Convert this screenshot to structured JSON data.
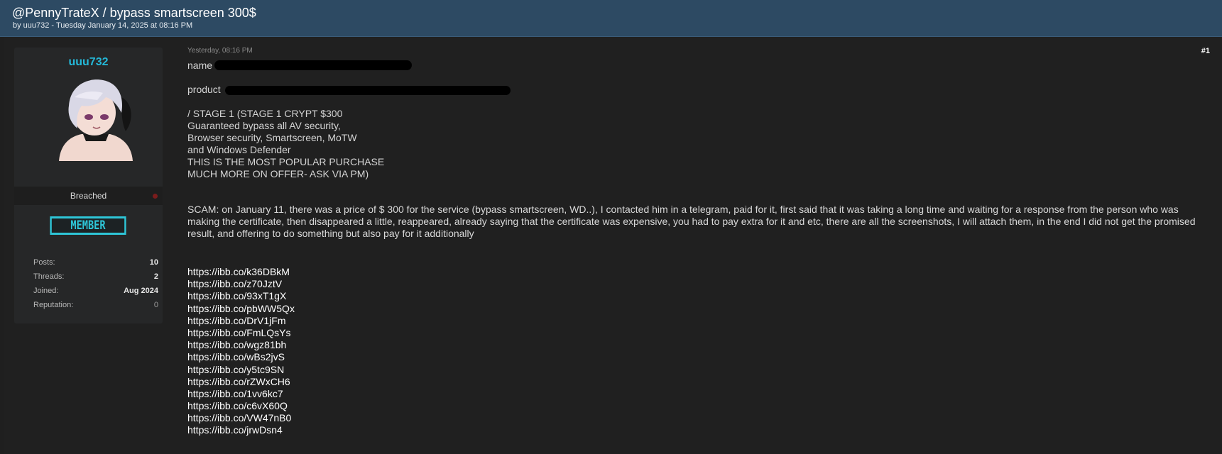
{
  "thread": {
    "title": "@PennyTrateX / bypass smartscreen 300$",
    "meta": "by uuu732 - Tuesday January 14, 2025 at 08:16 PM"
  },
  "user": {
    "username": "uuu732",
    "group": "Breached",
    "rank": "MEMBER",
    "stats": [
      {
        "label": "Posts:",
        "value": "10"
      },
      {
        "label": "Threads:",
        "value": "2"
      },
      {
        "label": "Joined:",
        "value": "Aug 2024"
      },
      {
        "label": "Reputation:",
        "value": "0"
      }
    ],
    "colors": {
      "username": "#24b8d8",
      "rank": "#2ec6d8",
      "status": "#7a1c1c"
    }
  },
  "post": {
    "date": "Yesterday, 08:16 PM",
    "number": "#1",
    "name_label": "name",
    "product_label": "product",
    "offer_lines": [
      "/ STAGE 1 (STAGE 1 CRYPT $300",
      "Guaranteed bypass all AV security,",
      "Browser security, Smartscreen, MoTW",
      "and Windows Defender",
      "THIS IS THE MOST POPULAR PURCHASE",
      "MUCH MORE ON OFFER- ASK VIA PM)"
    ],
    "scam_text": "SCAM: on January 11, there was a price of $ 300 for the service (bypass smartscreen, WD..), I contacted him in a telegram, paid for it, first said that it was taking a long time and waiting for a response from the person who was making the certificate, then disappeared a little, reappeared, already saying that the certificate was expensive, you had to pay extra for it and etc, there are all the screenshots, I will attach them, in the end I did not get the promised result, and offering to do something but also pay for it additionally",
    "links": [
      "https://ibb.co/k36DBkM",
      "https://ibb.co/z70JztV",
      "https://ibb.co/93xT1gX",
      "https://ibb.co/pbWW5Qx",
      "https://ibb.co/DrV1jFm",
      "https://ibb.co/FmLQsYs",
      "https://ibb.co/wgz81bh",
      "https://ibb.co/wBs2jvS",
      "https://ibb.co/y5tc9SN",
      "https://ibb.co/rZWxCH6",
      "https://ibb.co/1vv6kc7",
      "https://ibb.co/c6vX60Q",
      "https://ibb.co/VW47nB0",
      "https://ibb.co/jrwDsn4"
    ]
  }
}
